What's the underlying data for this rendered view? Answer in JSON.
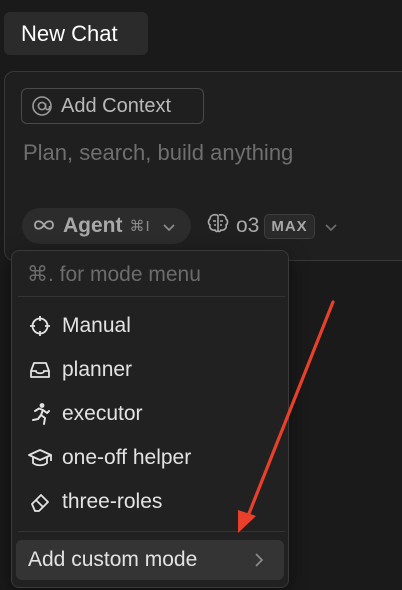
{
  "tab": {
    "label": "New Chat"
  },
  "composer": {
    "add_context_label": "Add Context",
    "placeholder": "Plan, search, build anything"
  },
  "mode_selector": {
    "label": "Agent",
    "shortcut": "⌘I"
  },
  "model_selector": {
    "name": "o3",
    "badge": "MAX"
  },
  "mode_menu": {
    "search_placeholder": "⌘. for mode menu",
    "items": [
      {
        "label": "Manual",
        "icon": "crosshair-icon"
      },
      {
        "label": "planner",
        "icon": "inbox-icon"
      },
      {
        "label": "executor",
        "icon": "running-person-icon"
      },
      {
        "label": "one-off helper",
        "icon": "graduation-cap-icon"
      },
      {
        "label": "three-roles",
        "icon": "eraser-icon"
      }
    ],
    "add_custom_label": "Add custom mode"
  },
  "annotation": {
    "arrow_color": "#e8402a"
  }
}
